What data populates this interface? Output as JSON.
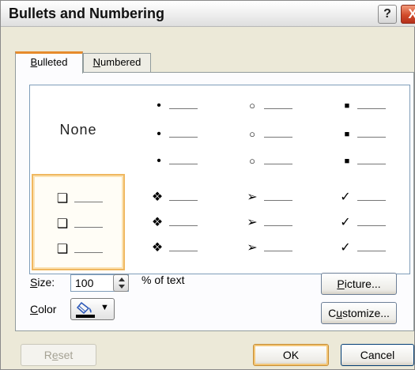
{
  "window": {
    "title": "Bullets and Numbering",
    "help_label": "?",
    "close_label": "X"
  },
  "tabs": [
    {
      "accel": "B",
      "rest": "ulleted",
      "active": true
    },
    {
      "accel": "N",
      "rest": "umbered",
      "active": false
    }
  ],
  "gallery": {
    "none_label": "None",
    "styles": [
      {
        "glyph": "•"
      },
      {
        "glyph": "○"
      },
      {
        "glyph": "■"
      },
      {
        "glyph": "❑"
      },
      {
        "glyph": "❖"
      },
      {
        "glyph": "➢"
      },
      {
        "glyph": "✓"
      }
    ],
    "selected": "hollow-square"
  },
  "size": {
    "label_accel": "S",
    "label_rest": "ize:",
    "value": "100",
    "suffix": "% of text"
  },
  "color": {
    "label_accel": "C",
    "label_rest": "olor",
    "arrow": "▼",
    "swatch": "#000000"
  },
  "buttons": {
    "picture": {
      "accel": "P",
      "rest": "icture..."
    },
    "customize": {
      "pre": "C",
      "accel": "u",
      "rest": "stomize..."
    },
    "reset": {
      "pre": "R",
      "accel": "e",
      "rest": "set"
    },
    "ok": "OK",
    "cancel": "Cancel"
  },
  "colors": {
    "accent": "#e68b2c",
    "selection_border": "#f0b860",
    "dialog_bg": "#ece9d8"
  }
}
